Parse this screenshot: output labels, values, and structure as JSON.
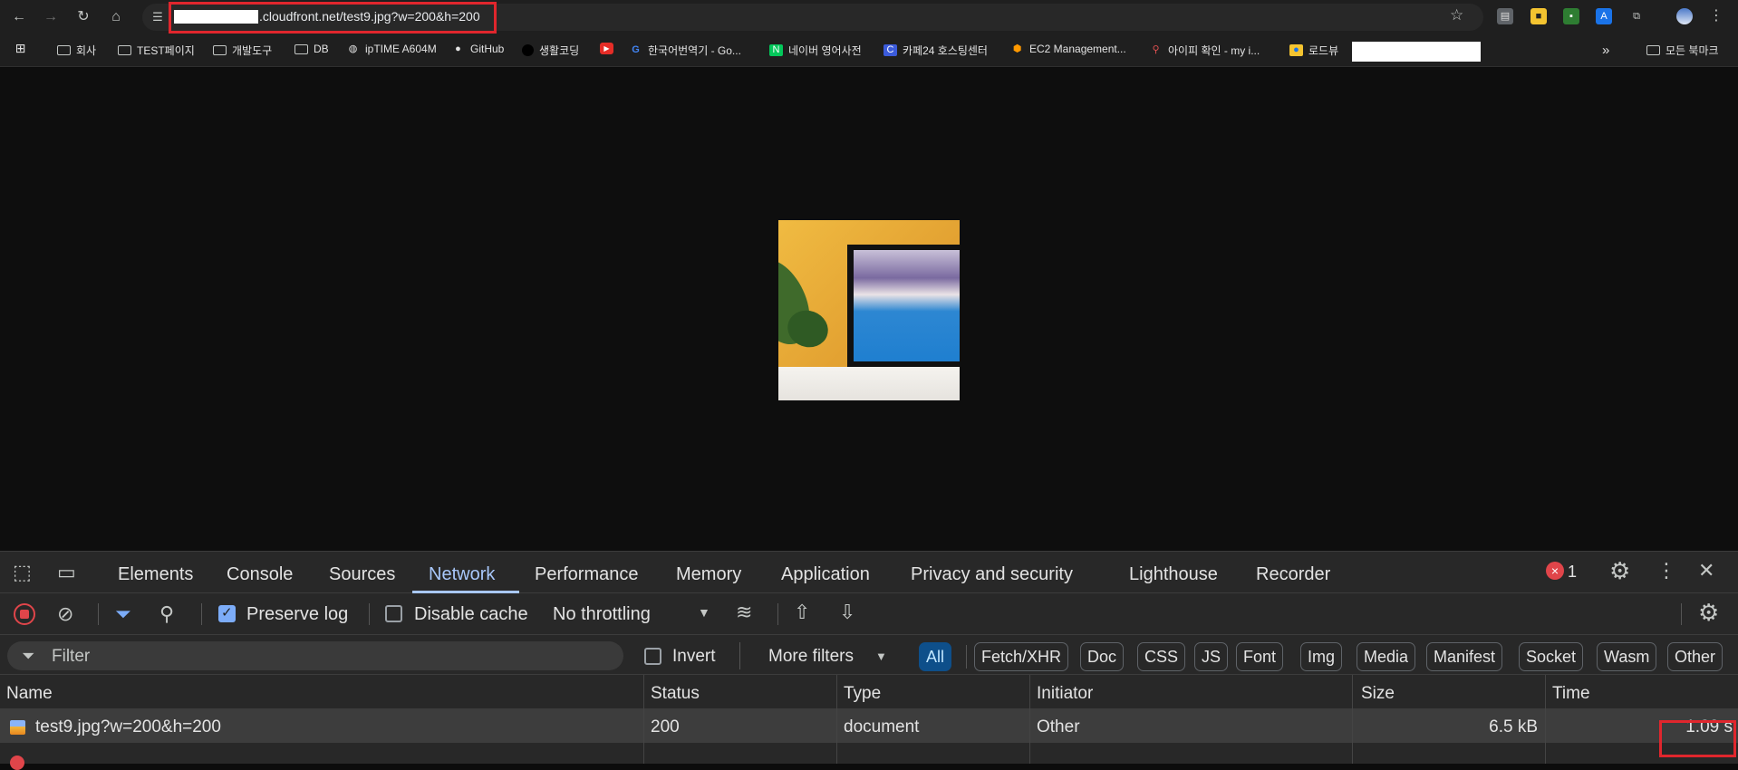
{
  "browser": {
    "url_visible": ".cloudfront.net/test9.jpg?w=200&h=200",
    "nav": {
      "back_icon": "arrow-left-icon",
      "forward_icon": "arrow-right-icon",
      "reload_icon": "reload-icon",
      "home_icon": "home-icon"
    },
    "bookmarks": [
      {
        "label": "회사",
        "icon": "folder-icon"
      },
      {
        "label": "TEST페이지",
        "icon": "folder-icon"
      },
      {
        "label": "개발도구",
        "icon": "folder-icon"
      },
      {
        "label": "DB",
        "icon": "folder-icon"
      },
      {
        "label": "ipTIME A604M",
        "icon": "globe-icon"
      },
      {
        "label": "GitHub",
        "icon": "github-icon"
      },
      {
        "label": "생활코딩",
        "icon": "circle-icon"
      },
      {
        "label": "",
        "icon": "youtube-icon"
      },
      {
        "label": "한국어번역기 - Go...",
        "icon": "google-icon"
      },
      {
        "label": "네이버 영어사전",
        "icon": "naver-icon"
      },
      {
        "label": "카페24 호스팅센터",
        "icon": "cafe24-icon"
      },
      {
        "label": "EC2 Management...",
        "icon": "aws-icon"
      },
      {
        "label": "아이피 확인 - my i...",
        "icon": "search-icon"
      },
      {
        "label": "로드뷰",
        "icon": "map-pin-icon"
      }
    ],
    "all_bookmarks": "모든 북마크",
    "overflow": "»"
  },
  "devtools": {
    "tabs": [
      "Elements",
      "Console",
      "Sources",
      "Network",
      "Performance",
      "Memory",
      "Application",
      "Privacy and security",
      "Lighthouse",
      "Recorder"
    ],
    "active_tab": "Network",
    "error_count": "1",
    "toolbar": {
      "preserve_log": "Preserve log",
      "disable_cache": "Disable cache",
      "throttling": "No throttling"
    },
    "filter": {
      "placeholder": "Filter",
      "invert": "Invert",
      "more_filters": "More filters",
      "chips": [
        "All",
        "Fetch/XHR",
        "Doc",
        "CSS",
        "JS",
        "Font",
        "Img",
        "Media",
        "Manifest",
        "Socket",
        "Wasm",
        "Other"
      ]
    },
    "table": {
      "headers": {
        "name": "Name",
        "status": "Status",
        "type": "Type",
        "initiator": "Initiator",
        "size": "Size",
        "time": "Time"
      },
      "rows": [
        {
          "name": "test9.jpg?w=200&h=200",
          "status": "200",
          "type": "document",
          "initiator": "Other",
          "size": "6.5 kB",
          "time": "1.09 s"
        }
      ]
    }
  }
}
